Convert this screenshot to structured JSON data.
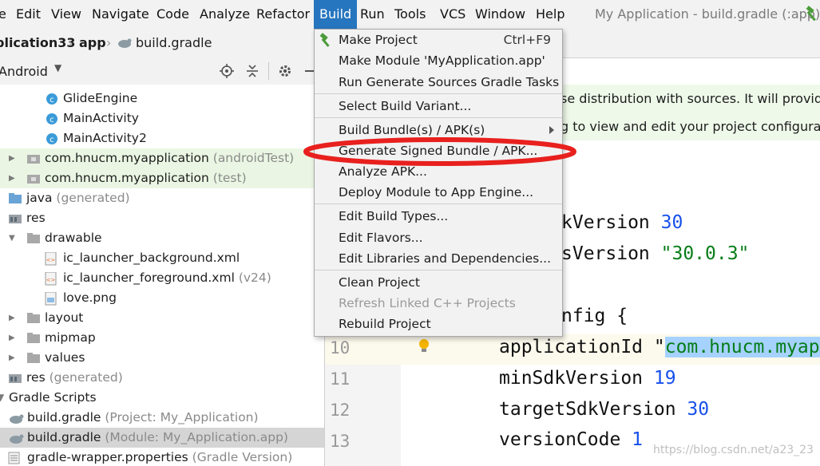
{
  "menubar": {
    "items": [
      "e",
      "Edit",
      "View",
      "Navigate",
      "Code",
      "Analyze",
      "Refactor",
      "Build",
      "Run",
      "Tools",
      "VCS",
      "Window",
      "Help"
    ],
    "window_title": "My Application - build.gradle (:app) -"
  },
  "breadcrumb": {
    "project": "plication33",
    "module": "app",
    "file": "build.gradle"
  },
  "project_toolbar": {
    "view_label": "Android"
  },
  "tree": [
    {
      "label": "GlideEngine",
      "suffix": "",
      "icon": "class-icon"
    },
    {
      "label": "MainActivity",
      "suffix": "",
      "icon": "class-icon"
    },
    {
      "label": "MainActivity2",
      "suffix": "",
      "icon": "class-icon"
    },
    {
      "label": "com.hnucm.myapplication",
      "suffix": "(androidTest)",
      "icon": "package-icon"
    },
    {
      "label": "com.hnucm.myapplication",
      "suffix": "(test)",
      "icon": "package-icon"
    },
    {
      "label": "java",
      "suffix": "(generated)",
      "icon": "source-folder-icon"
    },
    {
      "label": "res",
      "suffix": "",
      "icon": "res-folder-icon"
    },
    {
      "label": "drawable",
      "suffix": "",
      "icon": "folder-icon"
    },
    {
      "label": "ic_launcher_background.xml",
      "suffix": "",
      "icon": "xml-file-icon"
    },
    {
      "label": "ic_launcher_foreground.xml",
      "suffix": "(v24)",
      "icon": "xml-file-icon"
    },
    {
      "label": "love.png",
      "suffix": "",
      "icon": "image-file-icon"
    },
    {
      "label": "layout",
      "suffix": "",
      "icon": "folder-icon"
    },
    {
      "label": "mipmap",
      "suffix": "",
      "icon": "folder-icon"
    },
    {
      "label": "values",
      "suffix": "",
      "icon": "folder-icon"
    },
    {
      "label": "res",
      "suffix": "(generated)",
      "icon": "res-folder-icon"
    },
    {
      "label": "Gradle Scripts",
      "suffix": "",
      "icon": "gradle-icon"
    },
    {
      "label": "build.gradle",
      "suffix": "(Project: My_Application)",
      "icon": "gradle-icon"
    },
    {
      "label": "build.gradle",
      "suffix": "(Module: My_Application.app)",
      "icon": "gradle-icon"
    },
    {
      "label": "gradle-wrapper.properties",
      "suffix": "(Gradle Version)",
      "icon": "properties-file-icon"
    }
  ],
  "editor": {
    "notice_line1": "se distribution with sources. It will provide ID",
    "notice_line2": "g to view and edit your project configuration",
    "lines": [
      {
        "num": "",
        "pre": "kVersion ",
        "val": "30",
        "kind": "num"
      },
      {
        "num": "",
        "pre": "sVersion ",
        "val": "\"30.0.3\"",
        "kind": "str"
      },
      {
        "num": "",
        "pre": "nfig {",
        "val": "",
        "kind": ""
      },
      {
        "num": "10",
        "pre": "applicationId \"",
        "val": "com.hnucm.myap",
        "kind": "str"
      },
      {
        "num": "11",
        "pre": "minSdkVersion ",
        "val": "19",
        "kind": "num"
      },
      {
        "num": "12",
        "pre": "targetSdkVersion ",
        "val": "30",
        "kind": "num"
      },
      {
        "num": "13",
        "pre": "versionCode ",
        "val": "1",
        "kind": "num"
      }
    ]
  },
  "build_menu": {
    "items": [
      {
        "label": "Make Project",
        "shortcut": "Ctrl+F9"
      },
      {
        "label": "Make Module 'MyApplication.app'",
        "shortcut": ""
      },
      {
        "label": "Run Generate Sources Gradle Tasks",
        "shortcut": ""
      },
      {
        "label": "Select Build Variant...",
        "shortcut": ""
      },
      {
        "label": "Build Bundle(s) / APK(s)",
        "shortcut": ""
      },
      {
        "label": "Generate Signed Bundle / APK...",
        "shortcut": ""
      },
      {
        "label": "Analyze APK...",
        "shortcut": ""
      },
      {
        "label": "Deploy Module to App Engine...",
        "shortcut": ""
      },
      {
        "label": "Edit Build Types...",
        "shortcut": ""
      },
      {
        "label": "Edit Flavors...",
        "shortcut": ""
      },
      {
        "label": "Edit Libraries and Dependencies...",
        "shortcut": ""
      },
      {
        "label": "Clean Project",
        "shortcut": ""
      },
      {
        "label": "Refresh Linked C++ Projects",
        "shortcut": ""
      },
      {
        "label": "Rebuild Project",
        "shortcut": ""
      }
    ]
  },
  "watermark": "https://blog.csdn.net/a23_23",
  "colors": {
    "accent": "#2675bf",
    "highlight_ellipse": "#e8201e",
    "selection_blue": "#a6d2ff"
  }
}
